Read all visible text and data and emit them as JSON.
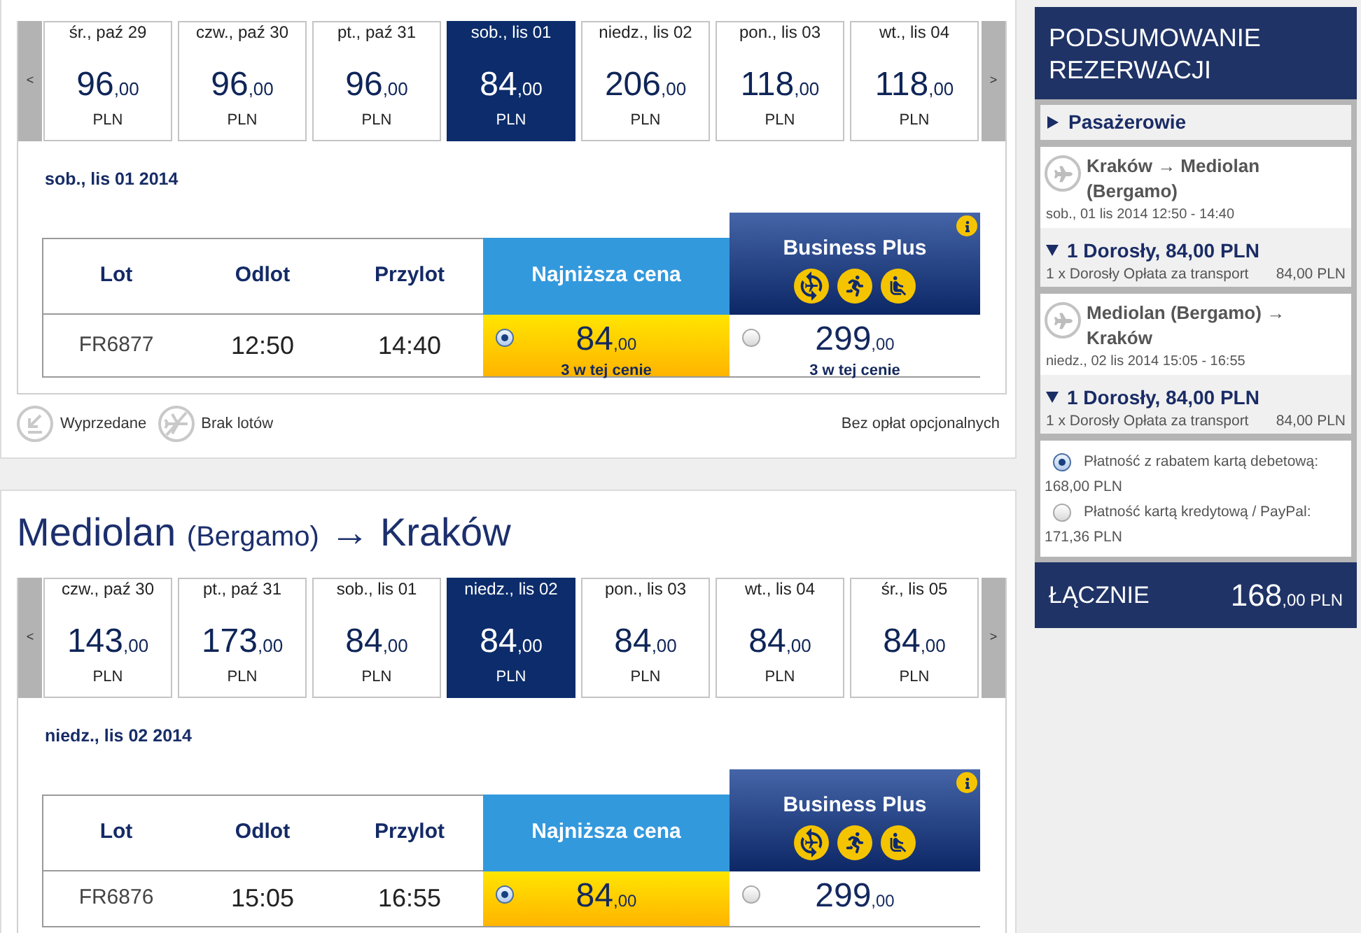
{
  "outbound": {
    "nav": {
      "prev": "<",
      "next": ">"
    },
    "dates": [
      {
        "day": "śr., paź 29",
        "price": "96",
        "decimals": ",00",
        "currency": "PLN",
        "selected": false
      },
      {
        "day": "czw., paź 30",
        "price": "96",
        "decimals": ",00",
        "currency": "PLN",
        "selected": false
      },
      {
        "day": "pt., paź 31",
        "price": "96",
        "decimals": ",00",
        "currency": "PLN",
        "selected": false
      },
      {
        "day": "sob., lis 01",
        "price": "84",
        "decimals": ",00",
        "currency": "PLN",
        "selected": true
      },
      {
        "day": "niedz., lis 02",
        "price": "206",
        "decimals": ",00",
        "currency": "PLN",
        "selected": false
      },
      {
        "day": "pon., lis 03",
        "price": "118",
        "decimals": ",00",
        "currency": "PLN",
        "selected": false
      },
      {
        "day": "wt., lis 04",
        "price": "118",
        "decimals": ",00",
        "currency": "PLN",
        "selected": false
      }
    ],
    "date_heading": "sob., lis 01 2014",
    "columns": [
      "Lot",
      "Odlot",
      "Przylot"
    ],
    "fares": [
      {
        "kind": "standard",
        "name": "Najniższa cena"
      },
      {
        "kind": "business",
        "name": "Business Plus"
      }
    ],
    "flights": [
      {
        "number": "FR6877",
        "departure": "12:50",
        "arrival": "14:40",
        "prices": [
          {
            "price": "84",
            "decimals": ",00",
            "availability": "3 w tej cenie",
            "selected": true
          },
          {
            "price": "299",
            "decimals": ",00",
            "availability": "3 w tej cenie",
            "selected": false
          }
        ]
      }
    ],
    "legend": [
      {
        "kind": "sold_out",
        "label": "Wyprzedane"
      },
      {
        "kind": "no_flights",
        "label": "Brak lotów"
      }
    ],
    "note": "Bez opłat opcjonalnych"
  },
  "return": {
    "title": {
      "from": "Mediolan",
      "from_airport": "(Bergamo)",
      "arrow": "→",
      "to": "Kraków"
    },
    "nav": {
      "prev": "<",
      "next": ">"
    },
    "dates": [
      {
        "day": "czw., paź 30",
        "price": "143",
        "decimals": ",00",
        "currency": "PLN",
        "selected": false
      },
      {
        "day": "pt., paź 31",
        "price": "173",
        "decimals": ",00",
        "currency": "PLN",
        "selected": false
      },
      {
        "day": "sob., lis 01",
        "price": "84",
        "decimals": ",00",
        "currency": "PLN",
        "selected": false
      },
      {
        "day": "niedz., lis 02",
        "price": "84",
        "decimals": ",00",
        "currency": "PLN",
        "selected": true
      },
      {
        "day": "pon., lis 03",
        "price": "84",
        "decimals": ",00",
        "currency": "PLN",
        "selected": false
      },
      {
        "day": "wt., lis 04",
        "price": "84",
        "decimals": ",00",
        "currency": "PLN",
        "selected": false
      },
      {
        "day": "śr., lis 05",
        "price": "84",
        "decimals": ",00",
        "currency": "PLN",
        "selected": false
      }
    ],
    "date_heading": "niedz., lis 02 2014",
    "columns": [
      "Lot",
      "Odlot",
      "Przylot"
    ],
    "fares": [
      {
        "kind": "standard",
        "name": "Najniższa cena"
      },
      {
        "kind": "business",
        "name": "Business Plus"
      }
    ],
    "flights": [
      {
        "number": "FR6876",
        "departure": "15:05",
        "arrival": "16:55",
        "prices": [
          {
            "price": "84",
            "decimals": ",00",
            "selected": true
          },
          {
            "price": "299",
            "decimals": ",00",
            "selected": false
          }
        ]
      }
    ]
  },
  "summary": {
    "title": "PODSUMOWANIE REZERWACJI",
    "passengers": {
      "label": "Pasażerowie",
      "expanded": false
    },
    "flights": [
      {
        "route": "Kraków → Mediolan (Bergamo)",
        "schedule": "sob., 01 lis 2014 12:50 - 14:40",
        "fare": {
          "label": "1 Dorosły, 84,00 PLN",
          "expanded": true,
          "lines": [
            {
              "label": "1 x Dorosły Opłata za transport",
              "amount": "84,00 PLN"
            }
          ]
        }
      },
      {
        "route": "Mediolan (Bergamo) → Kraków",
        "schedule": "niedz., 02 lis 2014 15:05 - 16:55",
        "fare": {
          "label": "1 Dorosły, 84,00 PLN",
          "expanded": true,
          "lines": [
            {
              "label": "1 x Dorosły Opłata za transport",
              "amount": "84,00 PLN"
            }
          ]
        }
      }
    ],
    "payments": [
      {
        "label": "Płatność z rabatem kartą debetową:",
        "amount": "168,00 PLN",
        "selected": true
      },
      {
        "label": "Płatność kartą kredytową / PayPal:",
        "amount": "171,36 PLN",
        "selected": false
      }
    ],
    "total": {
      "label": "ŁĄCZNIE",
      "price": "168",
      "decimals": ",00",
      "currency": "PLN"
    }
  }
}
